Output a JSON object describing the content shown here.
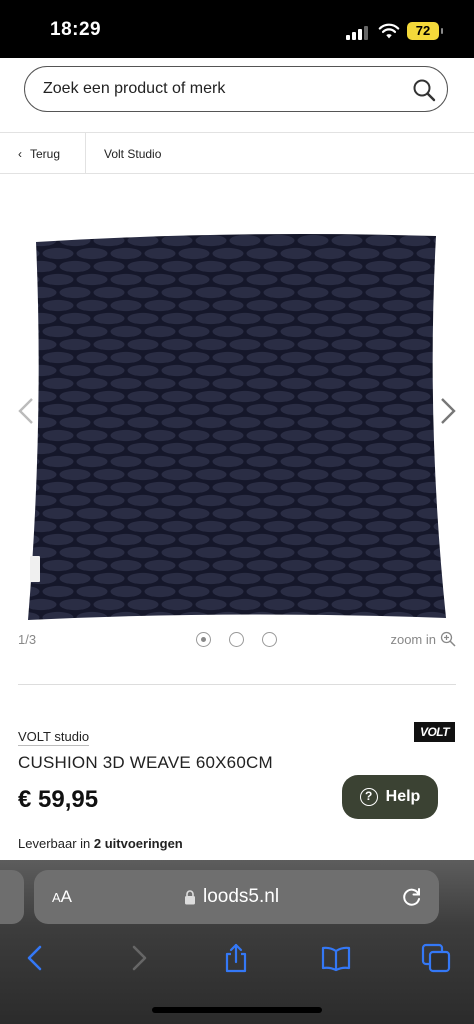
{
  "status_bar": {
    "time": "18:29",
    "battery": "72"
  },
  "search": {
    "placeholder": "Zoek een product of merk"
  },
  "nav": {
    "back_label": "Terug",
    "brand_link": "Volt Studio"
  },
  "gallery": {
    "counter": "1/3",
    "zoom_label": "zoom in",
    "dots": 3,
    "active_dot": 1
  },
  "product": {
    "brand": "VOLT studio",
    "logo_text": "VOLT",
    "title": "CUSHION 3D WEAVE 60X60CM",
    "price": "€ 59,95",
    "availability_prefix": "Leverbaar in ",
    "availability_bold": "2 uitvoeringen"
  },
  "help": {
    "label": "Help"
  },
  "browser": {
    "aa_small": "A",
    "aa_large": "A",
    "url": "loods5.nl"
  },
  "colors": {
    "help_bg": "#3b4233",
    "battery": "#f4d93a",
    "toolbar_icon": "#3478f6",
    "pillow": "#23263a"
  }
}
